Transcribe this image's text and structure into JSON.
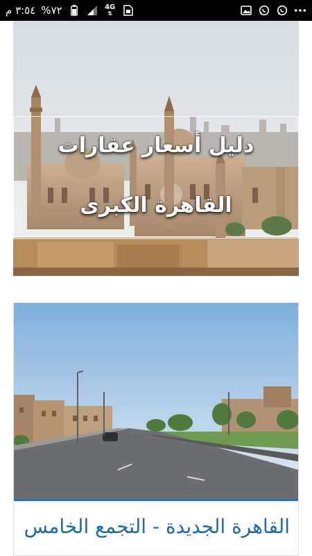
{
  "status_bar": {
    "time": "٣:٥٤ م",
    "battery_percent": "%٧٢",
    "network_type": "4G",
    "icons": [
      "photo-icon",
      "whatsapp-icon",
      "whatsapp-icon",
      "more-dots-icon",
      "network-4g-icon",
      "signal-icon",
      "battery-icon",
      "sim-icon"
    ]
  },
  "featured_card": {
    "headline_line1": "دليل أسعار عقارات",
    "headline_line2": "القاهرة الكبرى"
  },
  "article_card": {
    "title": "القاهرة الجديدة - التجمع الخامس"
  },
  "colors": {
    "accent": "#2476b4",
    "title_text": "#1e6aa8",
    "status_bar_bg": "#000000"
  }
}
